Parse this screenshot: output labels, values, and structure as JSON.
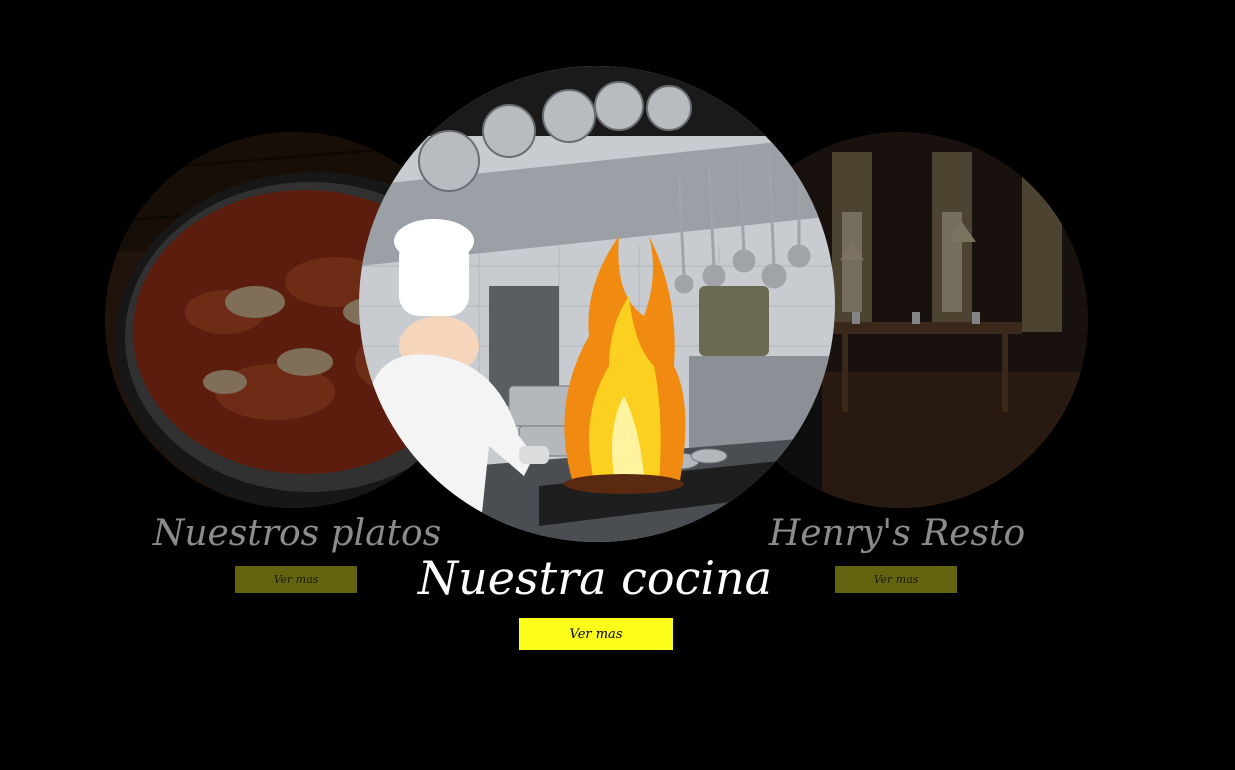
{
  "slides": {
    "left": {
      "title": "Nuestros platos",
      "button": "Ver mas"
    },
    "center": {
      "title": "Nuestra cocina",
      "button": "Ver mas"
    },
    "right": {
      "title": "Henry's Resto",
      "button": "Ver mas"
    }
  },
  "colors": {
    "background": "#000000",
    "accent_yellow": "#fdfd1c",
    "dim_yellow": "#646410",
    "side_title": "#8c8c8c"
  }
}
